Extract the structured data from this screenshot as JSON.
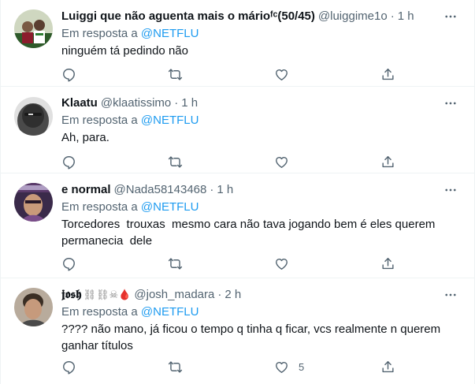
{
  "tweets": [
    {
      "name": "Luiggi que não aguenta mais o márioᶠᶜ(50/45)",
      "handle": "@luiggime1o",
      "time": "1 h",
      "reply_prefix": "Em resposta a",
      "reply_to": "@NETFLU",
      "text": "ninguém tá pedindo não",
      "likes": "",
      "avatar_color": "#5a6b3c"
    },
    {
      "name": "Klaatu",
      "handle": "@klaatissimo",
      "time": "1 h",
      "reply_prefix": "Em resposta a",
      "reply_to": "@NETFLU",
      "text": "Ah, para.",
      "likes": "",
      "avatar_color": "#6e6e6e"
    },
    {
      "name": "e normal",
      "handle": "@Nada58143468",
      "time": "1 h",
      "reply_prefix": "Em resposta a",
      "reply_to": "@NETFLU",
      "text": "Torcedores  trouxas  mesmo cara não tava jogando bem é eles querem\npermanecia  dele",
      "likes": "",
      "avatar_color": "#6b4d7a"
    },
    {
      "name": "𝖏𝖔𝖘𝖍",
      "name_emoji": "⛓⛓☠🩸",
      "handle": "@josh_madara",
      "time": "2 h",
      "reply_prefix": "Em resposta a",
      "reply_to": "@NETFLU",
      "text": "???? não mano, já ficou o tempo q tinha q ficar, vcs realmente n querem\nganhar títulos",
      "likes": "5",
      "avatar_color": "#8a7a6a"
    }
  ],
  "icons": {
    "reply": "reply-icon",
    "retweet": "retweet-icon",
    "like": "like-icon",
    "share": "share-icon",
    "more": "more-icon"
  },
  "colors": {
    "link": "#1d9bf0",
    "secondary_text": "#536471",
    "primary_text": "#0f1419",
    "divider": "#eff3f4"
  }
}
